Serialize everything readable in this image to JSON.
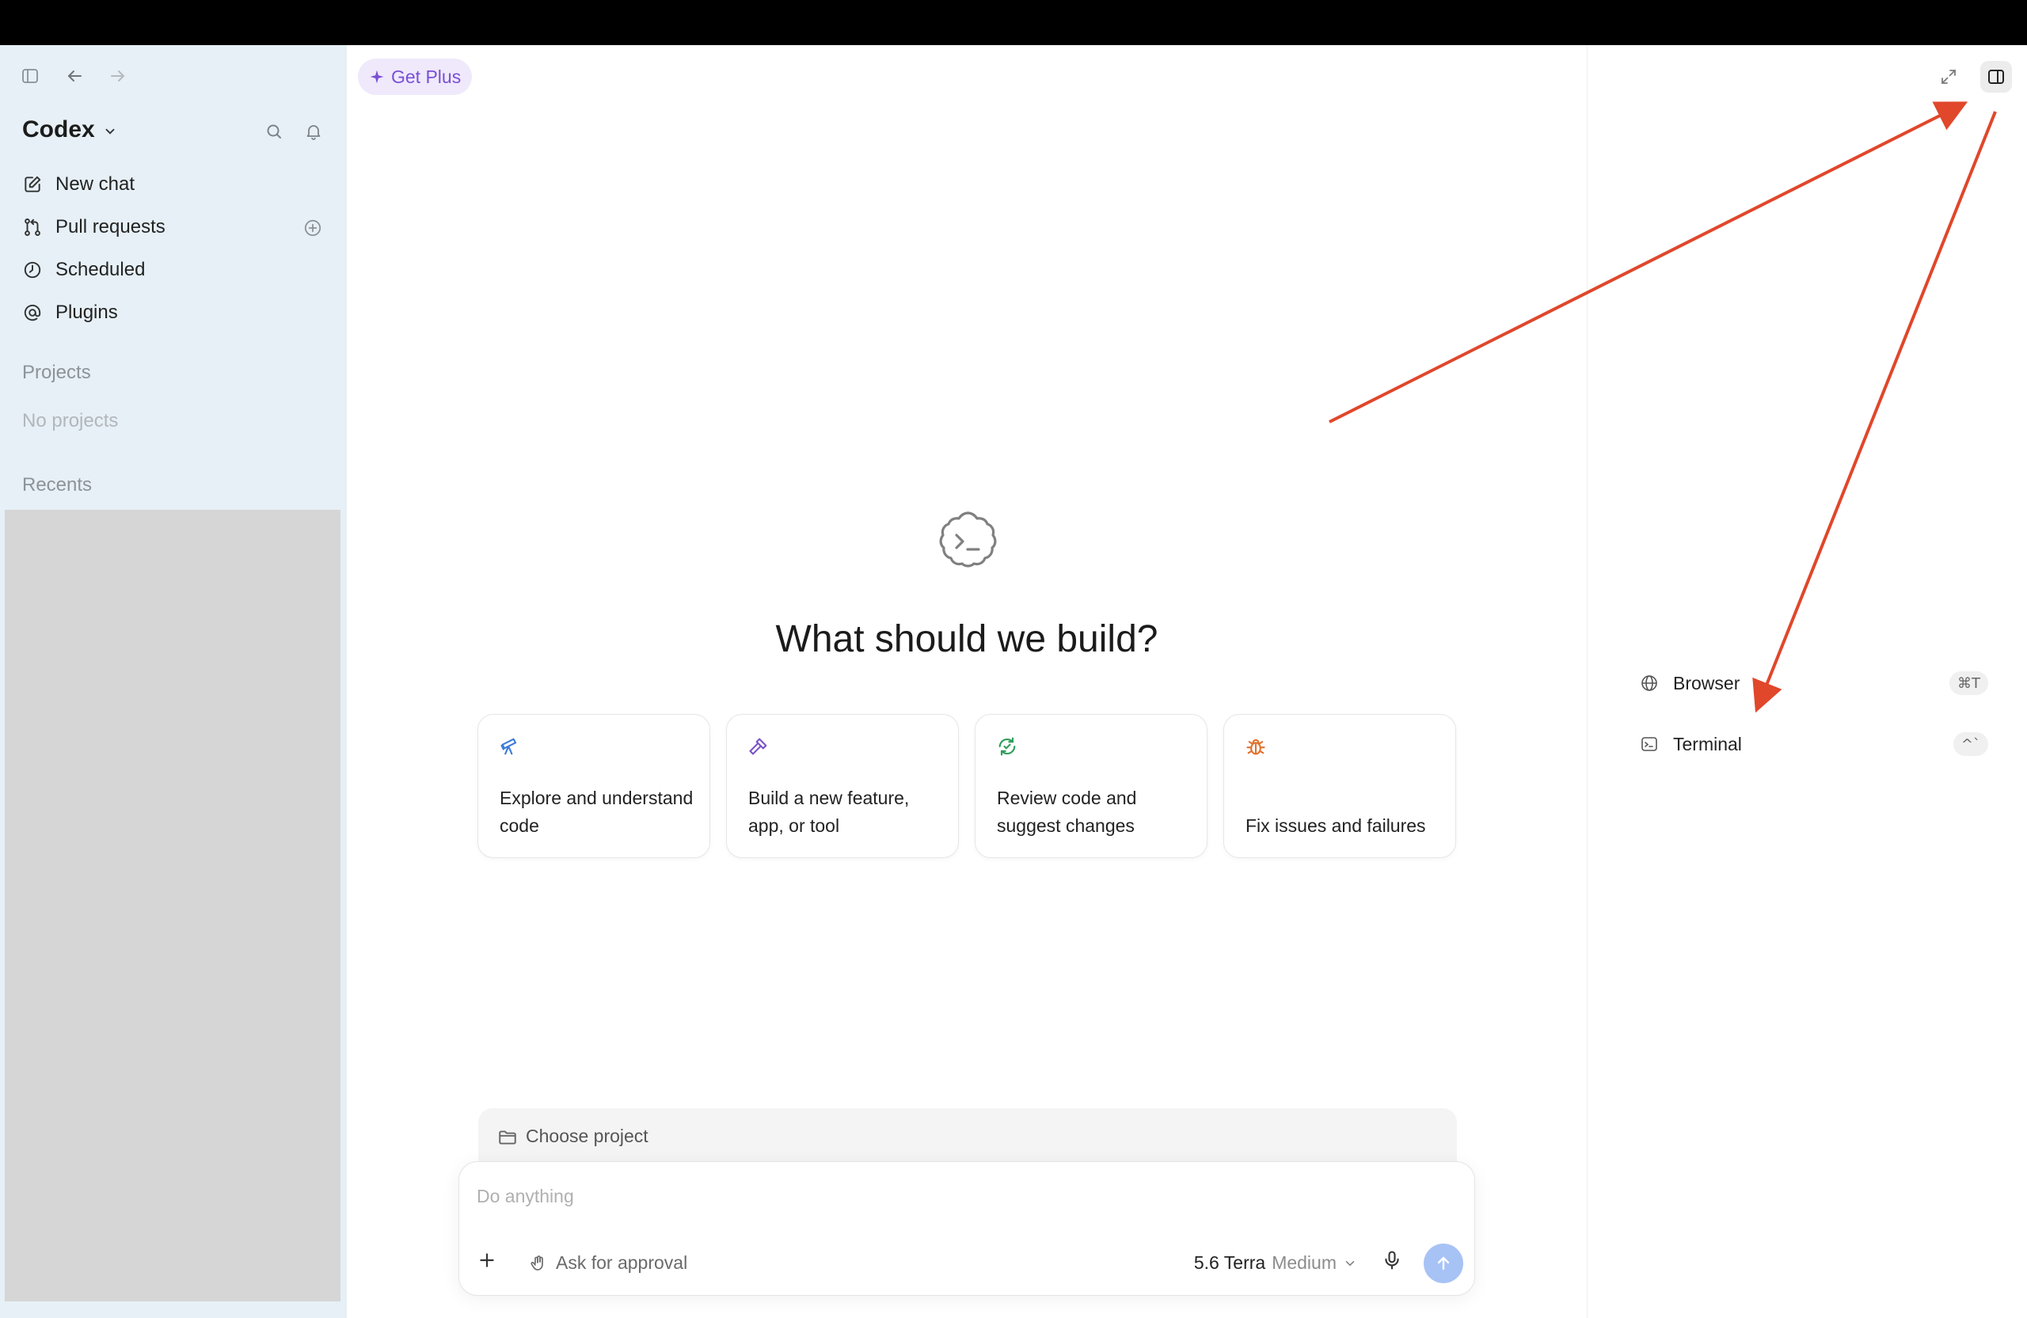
{
  "sidebar": {
    "app_name": "Codex",
    "nav": [
      {
        "label": "New chat",
        "icon": "edit-icon"
      },
      {
        "label": "Pull requests",
        "icon": "pull-request-icon"
      },
      {
        "label": "Scheduled",
        "icon": "clock-icon"
      },
      {
        "label": "Plugins",
        "icon": "at-icon"
      }
    ],
    "projects_label": "Projects",
    "projects_empty": "No projects",
    "recents_label": "Recents"
  },
  "main": {
    "get_plus": "Get Plus",
    "headline": "What should we build?",
    "cards": [
      {
        "label": "Explore and understand code",
        "icon": "telescope-icon",
        "color": "#3d7bd9"
      },
      {
        "label": "Build a new feature, app, or tool",
        "icon": "hammer-icon",
        "color": "#7a55c8"
      },
      {
        "label": "Review code and suggest changes",
        "icon": "review-cycle-icon",
        "color": "#2e9e5b"
      },
      {
        "label": "Fix issues and failures",
        "icon": "bug-icon",
        "color": "#e0722e"
      }
    ],
    "choose_project": "Choose project",
    "composer_placeholder": "Do anything",
    "approval_label": "Ask for approval",
    "model_name": "5.6 Terra",
    "model_level": "Medium"
  },
  "right_panel": {
    "items": [
      {
        "label": "Browser",
        "shortcut": "⌘T",
        "icon": "globe-icon"
      },
      {
        "label": "Terminal",
        "shortcut": "^`",
        "icon": "terminal-icon"
      }
    ]
  },
  "colors": {
    "sidebar_bg": "#e6f0f6",
    "accent_purple": "#7a4fd6",
    "send_button": "#a7c2f5",
    "annotation_arrow": "#e0472b"
  }
}
